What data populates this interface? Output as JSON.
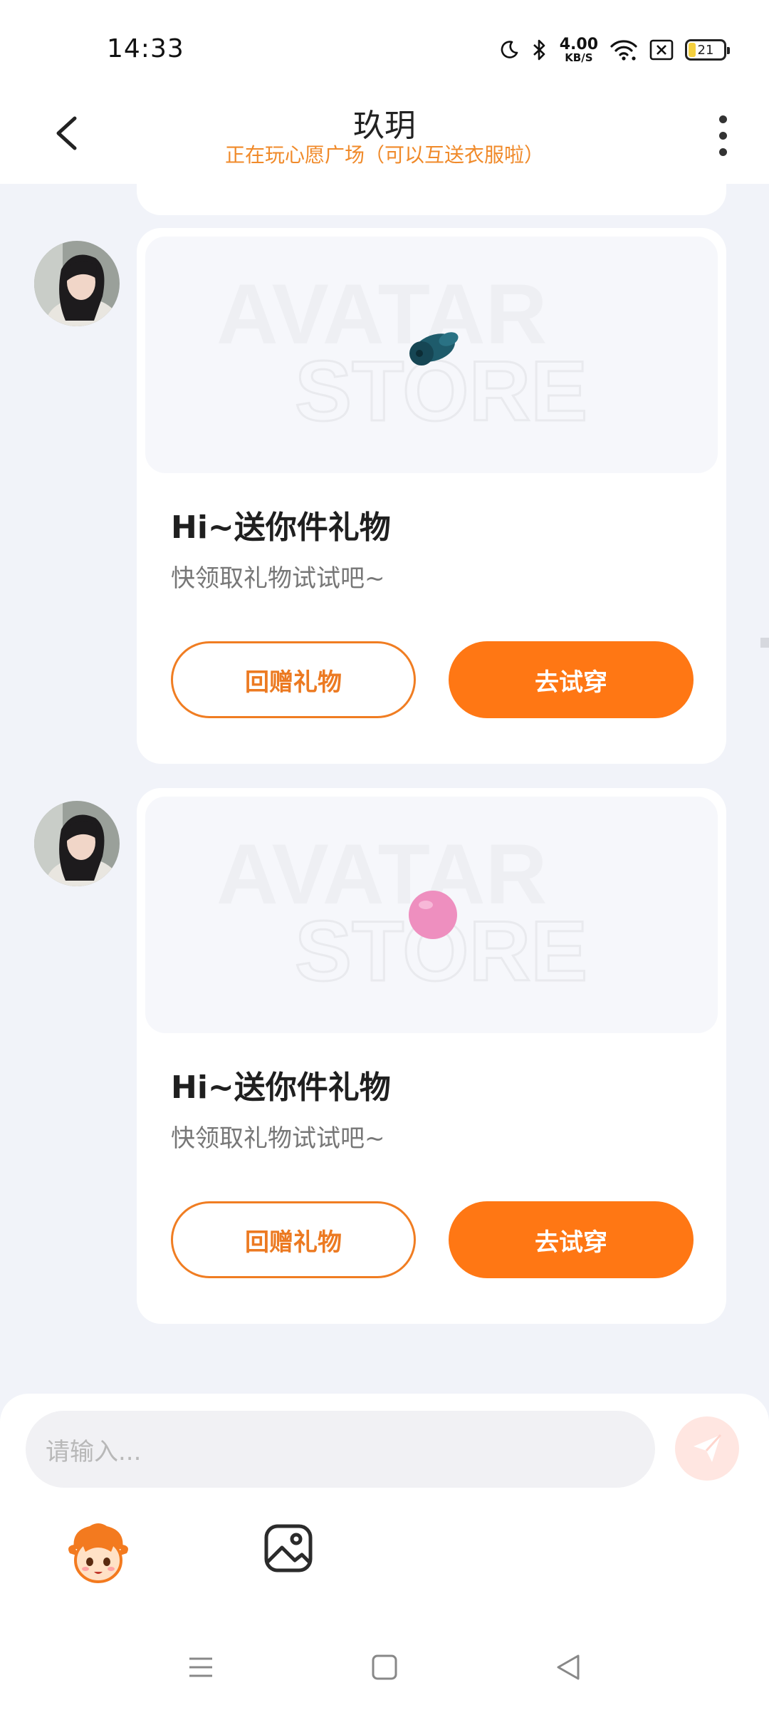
{
  "status_bar": {
    "time": "14:33",
    "net_speed_value": "4.00",
    "net_speed_unit": "KB/S",
    "battery_level": "21"
  },
  "header": {
    "title": "玖玥",
    "subtitle": "正在玩心愿广场（可以互送衣服啦）"
  },
  "messages": [
    {
      "watermark_line1": "AVATAR",
      "watermark_line2": "STORE",
      "gift_color": "#1e5b6b",
      "title": "Hi~送你件礼物",
      "subtitle": "快领取礼物试试吧~",
      "return_gift_label": "回赠礼物",
      "try_on_label": "去试穿"
    },
    {
      "watermark_line1": "AVATAR",
      "watermark_line2": "STORE",
      "gift_color": "#ee8fbf",
      "title": "Hi~送你件礼物",
      "subtitle": "快领取礼物试试吧~",
      "return_gift_label": "回赠礼物",
      "try_on_label": "去试穿"
    }
  ],
  "input": {
    "placeholder": "请输入..."
  },
  "colors": {
    "accent": "#ff7714",
    "subtitle": "#f08a2a"
  }
}
